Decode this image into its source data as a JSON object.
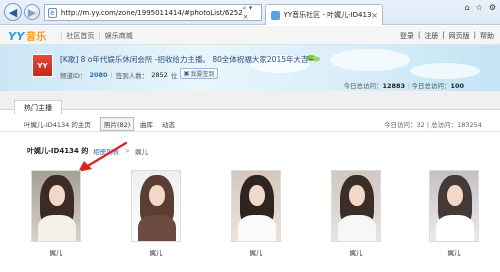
{
  "browser": {
    "url": "http://m.yy.com/zone/1995011414/#photoList/6252",
    "address_tools": "⌕ ▾ ×",
    "tab_title": "YY音乐社区 - 叶娓儿-ID4134",
    "tab_close": "×",
    "win_buttons": [
      "⌂",
      "☆",
      "⚙"
    ]
  },
  "topbar": {
    "logo": "YY",
    "logo_suffix": "音乐",
    "nav": [
      "社区首页",
      "娱乐商城"
    ],
    "links": [
      "登录",
      "注册",
      "网页版",
      "帮助"
    ]
  },
  "profile": {
    "avatar_text": "YY",
    "anchor_title": "[K歌] 8 o年代娱乐休闲会所 -招收给力主播。 80全体祝福大家2015年大吉~",
    "frame_label": "频道ID：",
    "frame_id": "2080",
    "followers_label": "签到人数：",
    "followers": "2852",
    "followers_unit": "位",
    "sign_button": "我要签到",
    "visits_today_label": "今日总访问：",
    "visits_today": "12883",
    "visits_total_label": "今日总访问：",
    "visits_total": "100"
  },
  "tabs": {
    "hot": "热门主播"
  },
  "subnav": {
    "home": "叶娓儿-ID4134 的主页",
    "photos": "照片(82)",
    "library": "曲库",
    "album": "动态",
    "right": "今日访问：32  |  总访问：183254"
  },
  "breadcrumb": {
    "owner": "叶娓儿-ID4134 的",
    "link": "相册列表",
    "sep": ">",
    "current": "娓儿"
  },
  "photos": [
    {
      "caption": "娓儿"
    },
    {
      "caption": "娓儿"
    },
    {
      "caption": "娓儿"
    },
    {
      "caption": "娓儿"
    },
    {
      "caption": "娓儿"
    }
  ],
  "colors": {
    "accent": "#2aa0e0",
    "annotation_arrow": "#e02020"
  }
}
